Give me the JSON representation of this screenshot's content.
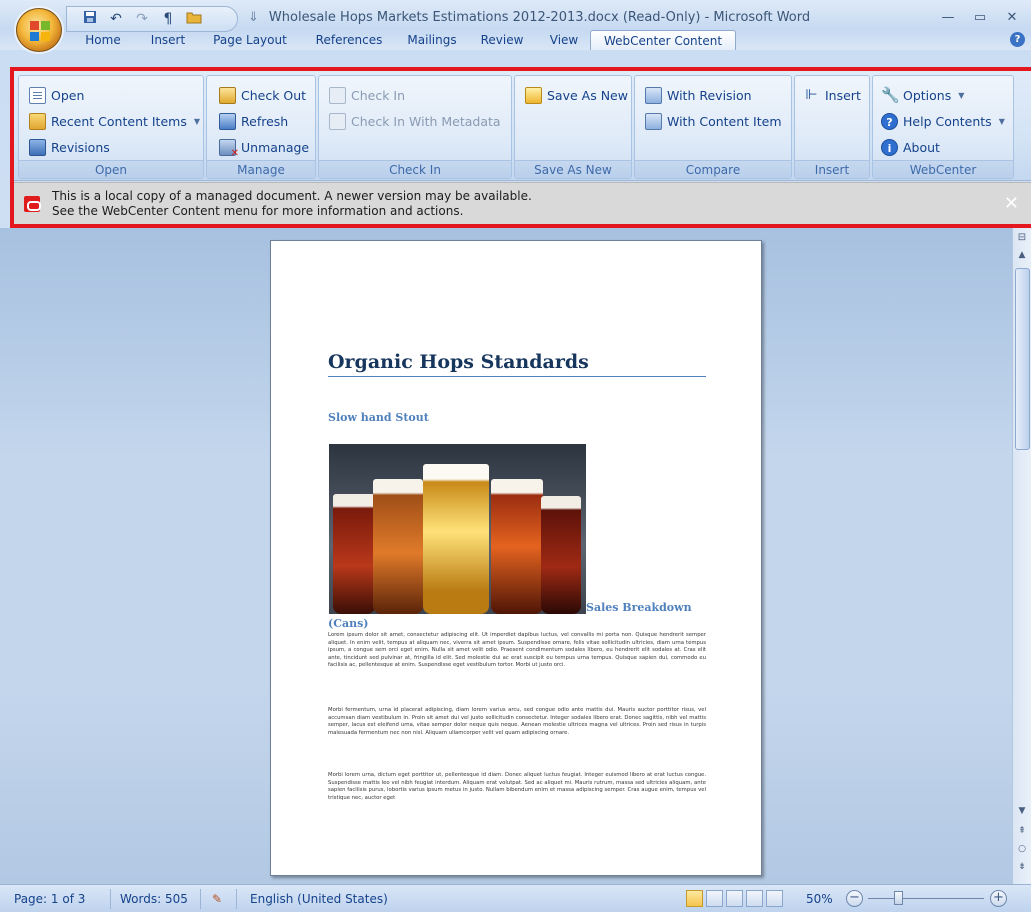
{
  "window": {
    "title": "Wholesale Hops Markets Estimations 2012-2013.docx (Read-Only) - Microsoft Word",
    "qat_separator": "⇓",
    "minimize": "—",
    "maximize": "▭",
    "close": "✕"
  },
  "qat": {
    "save_icon": "save-icon",
    "undo": "↶",
    "redo": "↷",
    "paragraph": "¶",
    "folder": "📂"
  },
  "tabs": [
    {
      "label": "Home"
    },
    {
      "label": "Insert"
    },
    {
      "label": "Page Layout"
    },
    {
      "label": "References"
    },
    {
      "label": "Mailings"
    },
    {
      "label": "Review"
    },
    {
      "label": "View"
    },
    {
      "label": "WebCenter Content",
      "active": true
    }
  ],
  "help_label": "?",
  "ribbon": {
    "open_group": {
      "label": "Open",
      "open": "Open",
      "recent": "Recent Content Items",
      "revisions": "Revisions"
    },
    "manage_group": {
      "label": "Manage",
      "checkout": "Check Out",
      "refresh": "Refresh",
      "unmanage": "Unmanage"
    },
    "checkin_group": {
      "label": "Check In",
      "checkin": "Check In",
      "checkin_meta": "Check In With Metadata"
    },
    "saveas_group": {
      "label": "Save As New",
      "saveas": "Save As New"
    },
    "compare_group": {
      "label": "Compare",
      "with_revision": "With Revision",
      "with_item": "With Content Item"
    },
    "insert_group": {
      "label": "Insert",
      "insert": "Insert"
    },
    "webcenter_group": {
      "label": "WebCenter",
      "options": "Options",
      "help": "Help Contents",
      "about": "About"
    }
  },
  "message_bar": {
    "line1": "This is a local copy of a managed document. A newer version may be available.",
    "line2": "See the WebCenter Content menu for more information and actions.",
    "close": "✕"
  },
  "document": {
    "title": "Organic Hops Standards",
    "heading1": "Slow hand Stout",
    "heading2a": "Sales Breakdown",
    "heading2b": "(Cans)",
    "para1": "Lorem ipsum dolor sit amet, consectetur adipiscing elit. Ut imperdiet dapibus luctus, vel convallis mi porta non. Quisque hendrerit semper aliquet. In enim velit, tempus at aliquam nec, viverra sit amet ipsum. Suspendisse ornare, felis vitae sollicitudin ultricies, diam urna tempus ipsum, a congue sem orci eget enim. Nulla sit amet velit odio. Praesent condimentum sodales libero, eu hendrerit elit sodales at. Cras elit ante, tincidunt sed pulvinar at, fringilla id elit. Sed molestie dui ac erat suscipit eu tempus urna tempus. Quisque sapien dui, commodo eu facilisis ac, pellentesque at enim. Suspendisse eget vestibulum tortor. Morbi ut justo orci.",
    "para2": "Morbi fermentum, urna id placerat adipiscing, diam lorem varius arcu, sed congue odio ante mattis dui. Mauris auctor porttitor risus, vel accumsan diam vestibulum in. Proin sit amet dui vel justo sollicitudin consectetur. Integer sodales libero erat. Donec sagittis, nibh vel mattis semper, lacus est eleifend urna, vitae semper dolor neque quis neque. Aenean molestie ultrices magna vel ultrices. Proin sed risus in turpis malesuada fermentum nec non nisl. Aliquam ullamcorper velit vel quam adipiscing ornare.",
    "para3": "Morbi lorem urna, dictum eget porttitor ut, pellentesque id diam. Donec aliquet luctus feugiat. Integer euismod libero at erat luctus congue. Suspendisse mattis leo vel nibh feugiat interdum. Aliquam erat volutpat. Sed ac aliquet mi. Mauris rutrum, massa sed ultricies aliquam, ante sapien facilisis purus, lobortis varius ipsum metus in justo. Nullam bibendum enim et massa adipiscing semper. Cras augue enim, tempus vel tristique nec, auctor eget"
  },
  "statusbar": {
    "page": "Page: 1 of 3",
    "words": "Words: 505",
    "language": "English (United States)",
    "zoom": "50%",
    "zoom_out": "−",
    "zoom_in": "+"
  },
  "colors": {
    "accent_red": "#e4161e",
    "heading_blue": "#4f81bd",
    "ribbon_text": "#15428b"
  }
}
